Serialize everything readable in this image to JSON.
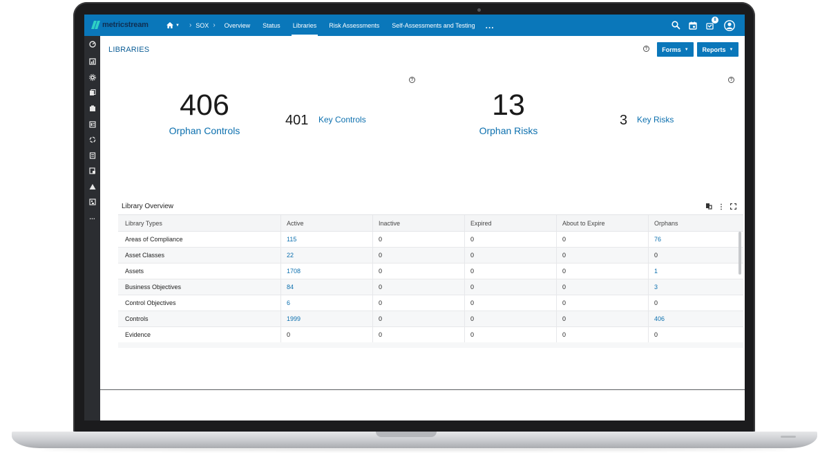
{
  "app": {
    "brand": "metricstream"
  },
  "nav": {
    "home_icon": "home-icon",
    "breadcrumb": "SOX",
    "items": [
      {
        "label": "Overview"
      },
      {
        "label": "Status"
      },
      {
        "label": "Libraries"
      },
      {
        "label": "Risk Assessments"
      },
      {
        "label": "Self-Assessments and Testing"
      }
    ],
    "more": "...",
    "active": "Libraries"
  },
  "topbar": {
    "notification_count": "8"
  },
  "page": {
    "title": "LIBRARIES",
    "help": "?",
    "forms_label": "Forms",
    "reports_label": "Reports"
  },
  "kpis": {
    "orphan_controls_value": "406",
    "orphan_controls_label": "Orphan Controls",
    "key_controls_value": "401",
    "key_controls_label": "Key Controls",
    "orphan_risks_value": "13",
    "orphan_risks_label": "Orphan Risks",
    "key_risks_value": "3",
    "key_risks_label": "Key Risks"
  },
  "library_overview": {
    "title": "Library Overview",
    "columns": [
      "Library Types",
      "Active",
      "Inactive",
      "Expired",
      "About to Expire",
      "Orphans"
    ],
    "rows": [
      [
        "Areas of Compliance",
        "115",
        "0",
        "0",
        "0",
        "76"
      ],
      [
        "Asset Classes",
        "22",
        "0",
        "0",
        "0",
        "0"
      ],
      [
        "Assets",
        "1708",
        "0",
        "0",
        "0",
        "1"
      ],
      [
        "Business Objectives",
        "84",
        "0",
        "0",
        "0",
        "3"
      ],
      [
        "Control Objectives",
        "6",
        "0",
        "0",
        "0",
        "0"
      ],
      [
        "Controls",
        "1999",
        "0",
        "0",
        "0",
        "406"
      ],
      [
        "Evidence",
        "0",
        "0",
        "0",
        "0",
        "0"
      ]
    ]
  },
  "colors": {
    "primary": "#0a77ba",
    "link": "#0b6fae",
    "sidebar": "#2b2d31"
  }
}
